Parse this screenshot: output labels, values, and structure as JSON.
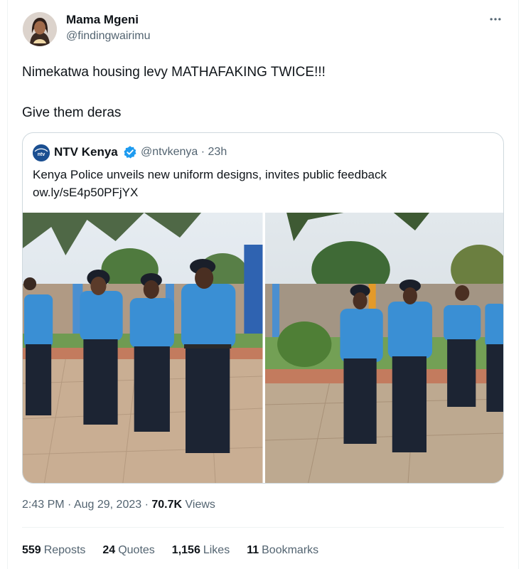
{
  "author": {
    "name": "Mama Mgeni",
    "handle": "@findingwairimu"
  },
  "tweet": {
    "line1": "Nimekatwa housing levy MATHAFAKING TWICE!!!",
    "line2": "Give them deras"
  },
  "quote": {
    "name": "NTV Kenya",
    "handle": "@ntvkenya",
    "separator": "·",
    "time": "23h",
    "avatar_text": "ntv",
    "text_line1": "Kenya Police unveils new uniform designs, invites public feedback",
    "text_line2": "ow.ly/sE4p50PFjYX"
  },
  "meta": {
    "time": "2:43 PM",
    "separator": "·",
    "date": "Aug 29, 2023",
    "views_count": "70.7K",
    "views_label": "Views"
  },
  "stats": [
    {
      "count": "559",
      "label": "Reposts"
    },
    {
      "count": "24",
      "label": "Quotes"
    },
    {
      "count": "1,156",
      "label": "Likes"
    },
    {
      "count": "11",
      "label": "Bookmarks"
    }
  ],
  "icons": {
    "more": "more-horizontal-icon",
    "verified": "verified-badge-icon"
  },
  "colors": {
    "primary_text": "#0f1419",
    "secondary_text": "#536471",
    "border": "#cfd9de",
    "verified": "#1d9bf0",
    "uniform_blue": "#3a8fd4"
  }
}
